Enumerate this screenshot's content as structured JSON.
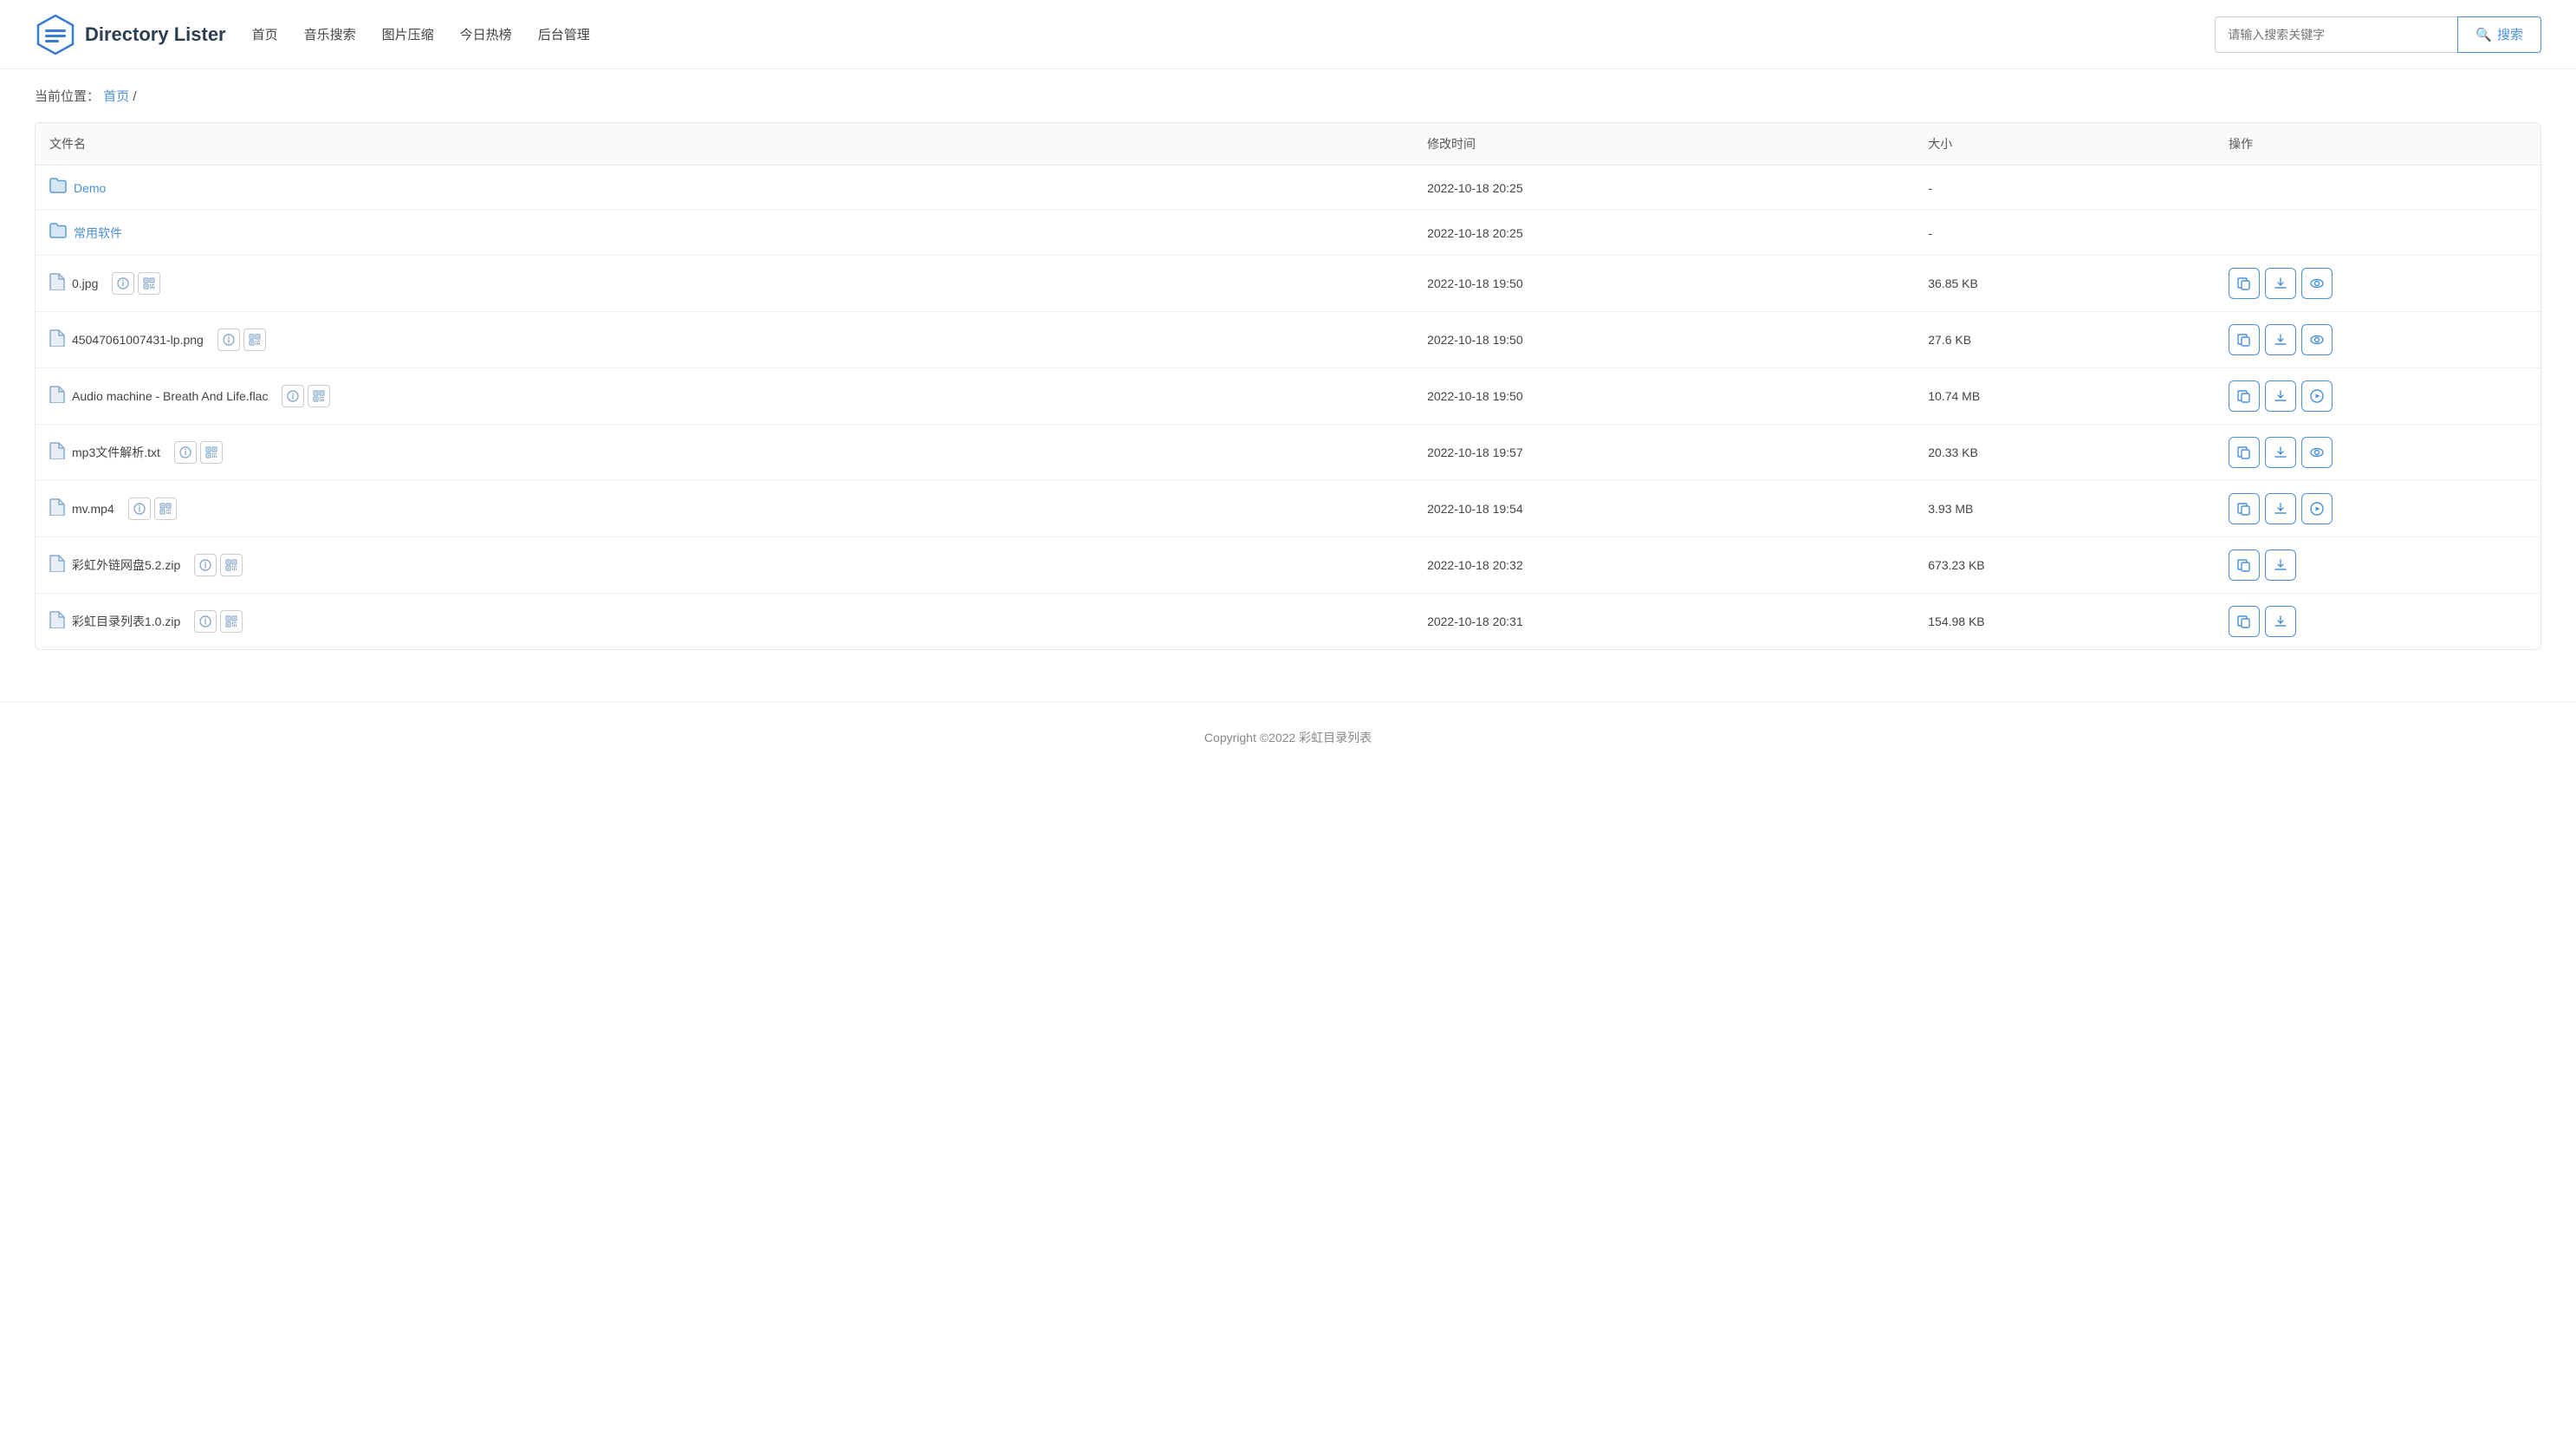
{
  "app": {
    "title": "Directory Lister"
  },
  "header": {
    "logo_text": "Directory Lister",
    "nav": [
      {
        "label": "首页",
        "key": "home"
      },
      {
        "label": "音乐搜索",
        "key": "music-search"
      },
      {
        "label": "图片压缩",
        "key": "image-compress"
      },
      {
        "label": "今日热榜",
        "key": "hot-list"
      },
      {
        "label": "后台管理",
        "key": "admin"
      }
    ],
    "search": {
      "placeholder": "请输入搜索关键字",
      "button_label": "搜索"
    }
  },
  "breadcrumb": {
    "prefix": "当前位置：",
    "home_link": "首页",
    "separator": " /"
  },
  "table": {
    "columns": [
      "文件名",
      "修改时间",
      "大小",
      "操作"
    ],
    "rows": [
      {
        "name": "Demo",
        "type": "folder",
        "modified": "2022-10-18 20:25",
        "size": "-",
        "has_info": false,
        "has_qr": false,
        "ops": []
      },
      {
        "name": "常用软件",
        "type": "folder",
        "modified": "2022-10-18 20:25",
        "size": "-",
        "has_info": false,
        "has_qr": false,
        "ops": []
      },
      {
        "name": "0.jpg",
        "type": "file",
        "modified": "2022-10-18 19:50",
        "size": "36.85 KB",
        "has_info": true,
        "has_qr": true,
        "ops": [
          "copy",
          "download",
          "preview"
        ]
      },
      {
        "name": "45047061007431-lp.png",
        "type": "file",
        "modified": "2022-10-18 19:50",
        "size": "27.6 KB",
        "has_info": true,
        "has_qr": true,
        "ops": [
          "copy",
          "download",
          "preview"
        ]
      },
      {
        "name": "Audio machine - Breath And Life.flac",
        "type": "file",
        "modified": "2022-10-18 19:50",
        "size": "10.74 MB",
        "has_info": true,
        "has_qr": true,
        "ops": [
          "copy",
          "download",
          "play"
        ]
      },
      {
        "name": "mp3文件解析.txt",
        "type": "file",
        "modified": "2022-10-18 19:57",
        "size": "20.33 KB",
        "has_info": true,
        "has_qr": true,
        "ops": [
          "copy",
          "download",
          "preview"
        ]
      },
      {
        "name": "mv.mp4",
        "type": "file",
        "modified": "2022-10-18 19:54",
        "size": "3.93 MB",
        "has_info": true,
        "has_qr": true,
        "ops": [
          "copy",
          "download",
          "play"
        ]
      },
      {
        "name": "彩虹外链网盘5.2.zip",
        "type": "file",
        "modified": "2022-10-18 20:32",
        "size": "673.23 KB",
        "has_info": true,
        "has_qr": true,
        "ops": [
          "copy",
          "download"
        ]
      },
      {
        "name": "彩虹目录列表1.0.zip",
        "type": "file",
        "modified": "2022-10-18 20:31",
        "size": "154.98 KB",
        "has_info": true,
        "has_qr": true,
        "ops": [
          "copy",
          "download"
        ]
      }
    ]
  },
  "footer": {
    "text": "Copyright ©2022 彩虹目录列表"
  },
  "icons": {
    "search": "🔍",
    "folder": "📁",
    "file": "📄",
    "copy": "⧉",
    "download": "⬇",
    "preview": "👁",
    "play": "▶",
    "info": "ℹ",
    "qr": "⊞"
  }
}
